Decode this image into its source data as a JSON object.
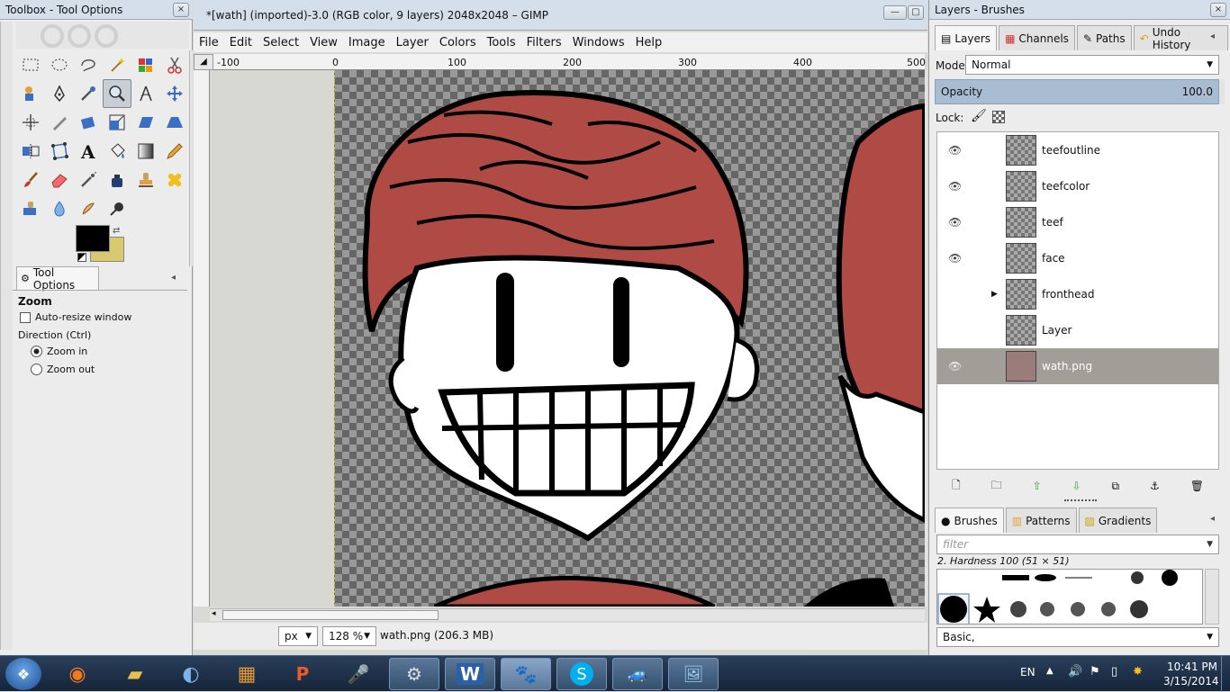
{
  "toolbox": {
    "title": "Toolbox - Tool Options",
    "close": "×",
    "tool_options_tab": "Tool Options",
    "zoom_heading": "Zoom",
    "auto_resize": "Auto-resize window",
    "direction_label": "Direction  (Ctrl)",
    "zoom_in": "Zoom in",
    "zoom_out": "Zoom out"
  },
  "image_window": {
    "title": "*[wath] (imported)-3.0 (RGB color, 9 layers) 2048x2048 – GIMP",
    "menu": [
      "File",
      "Edit",
      "Select",
      "View",
      "Image",
      "Layer",
      "Colors",
      "Tools",
      "Filters",
      "Windows",
      "Help"
    ],
    "ruler_ticks": [
      "-100",
      "0",
      "100",
      "200",
      "300",
      "400",
      "500"
    ],
    "unit": "px",
    "zoom": "128 %",
    "status": "wath.png (206.3 MB)"
  },
  "layers_dock": {
    "title": "Layers - Brushes",
    "tabs": [
      "Layers",
      "Channels",
      "Paths",
      "Undo History"
    ],
    "mode_label": "Mode:",
    "mode_value": "Normal",
    "opacity_label": "Opacity",
    "opacity_value": "100.0",
    "lock_label": "Lock:",
    "layers": [
      {
        "name": "teefoutline",
        "visible": true
      },
      {
        "name": "teefcolor",
        "visible": true
      },
      {
        "name": "teef",
        "visible": true
      },
      {
        "name": "face",
        "visible": true
      },
      {
        "name": "fronthead",
        "visible": false
      },
      {
        "name": "Layer",
        "visible": false
      },
      {
        "name": "wath.png",
        "visible": true
      }
    ],
    "brush_tabs": [
      "Brushes",
      "Patterns",
      "Gradients"
    ],
    "filter_placeholder": "filter",
    "brush_name": "2. Hardness 100 (51 × 51)",
    "brush_tag": "Basic,"
  },
  "taskbar": {
    "language": "EN",
    "time": "10:41 PM",
    "date": "3/15/2014"
  },
  "colors": {
    "fg": "#000000",
    "bg": "#d8c970",
    "hair": "#b04a44"
  }
}
